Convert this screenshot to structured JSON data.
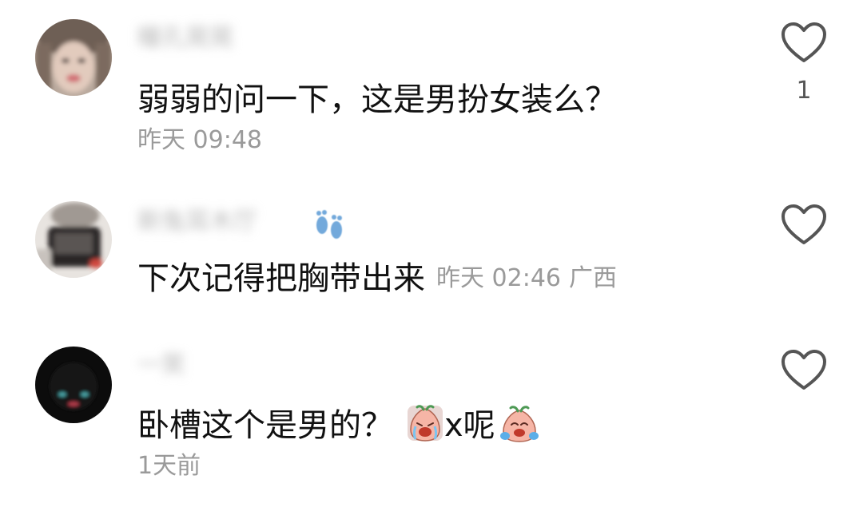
{
  "comments": [
    {
      "username": "瞳孔晃晃",
      "text": "弱弱的问一下，这是男扮女装么？",
      "time": "昨天 09:48",
      "likes": "1",
      "icons": {
        "like": "heart-outline-icon"
      }
    },
    {
      "username": "新兔耳木厅",
      "text": "下次记得把胸带出来",
      "time": "昨天 02:46",
      "location": "广西",
      "icons": {
        "like": "heart-outline-icon",
        "badge": "footprint-icon"
      }
    },
    {
      "username": "一笑",
      "text_before": "卧槽这个是男的？",
      "text_mid": "x呢",
      "time": "1天前",
      "icons": {
        "like": "heart-outline-icon",
        "emoji": "crying-radish-emoji"
      }
    }
  ],
  "colors": {
    "text": "#111111",
    "meta": "#9a9a9a",
    "icon_stroke": "#555555",
    "background": "#ffffff"
  }
}
